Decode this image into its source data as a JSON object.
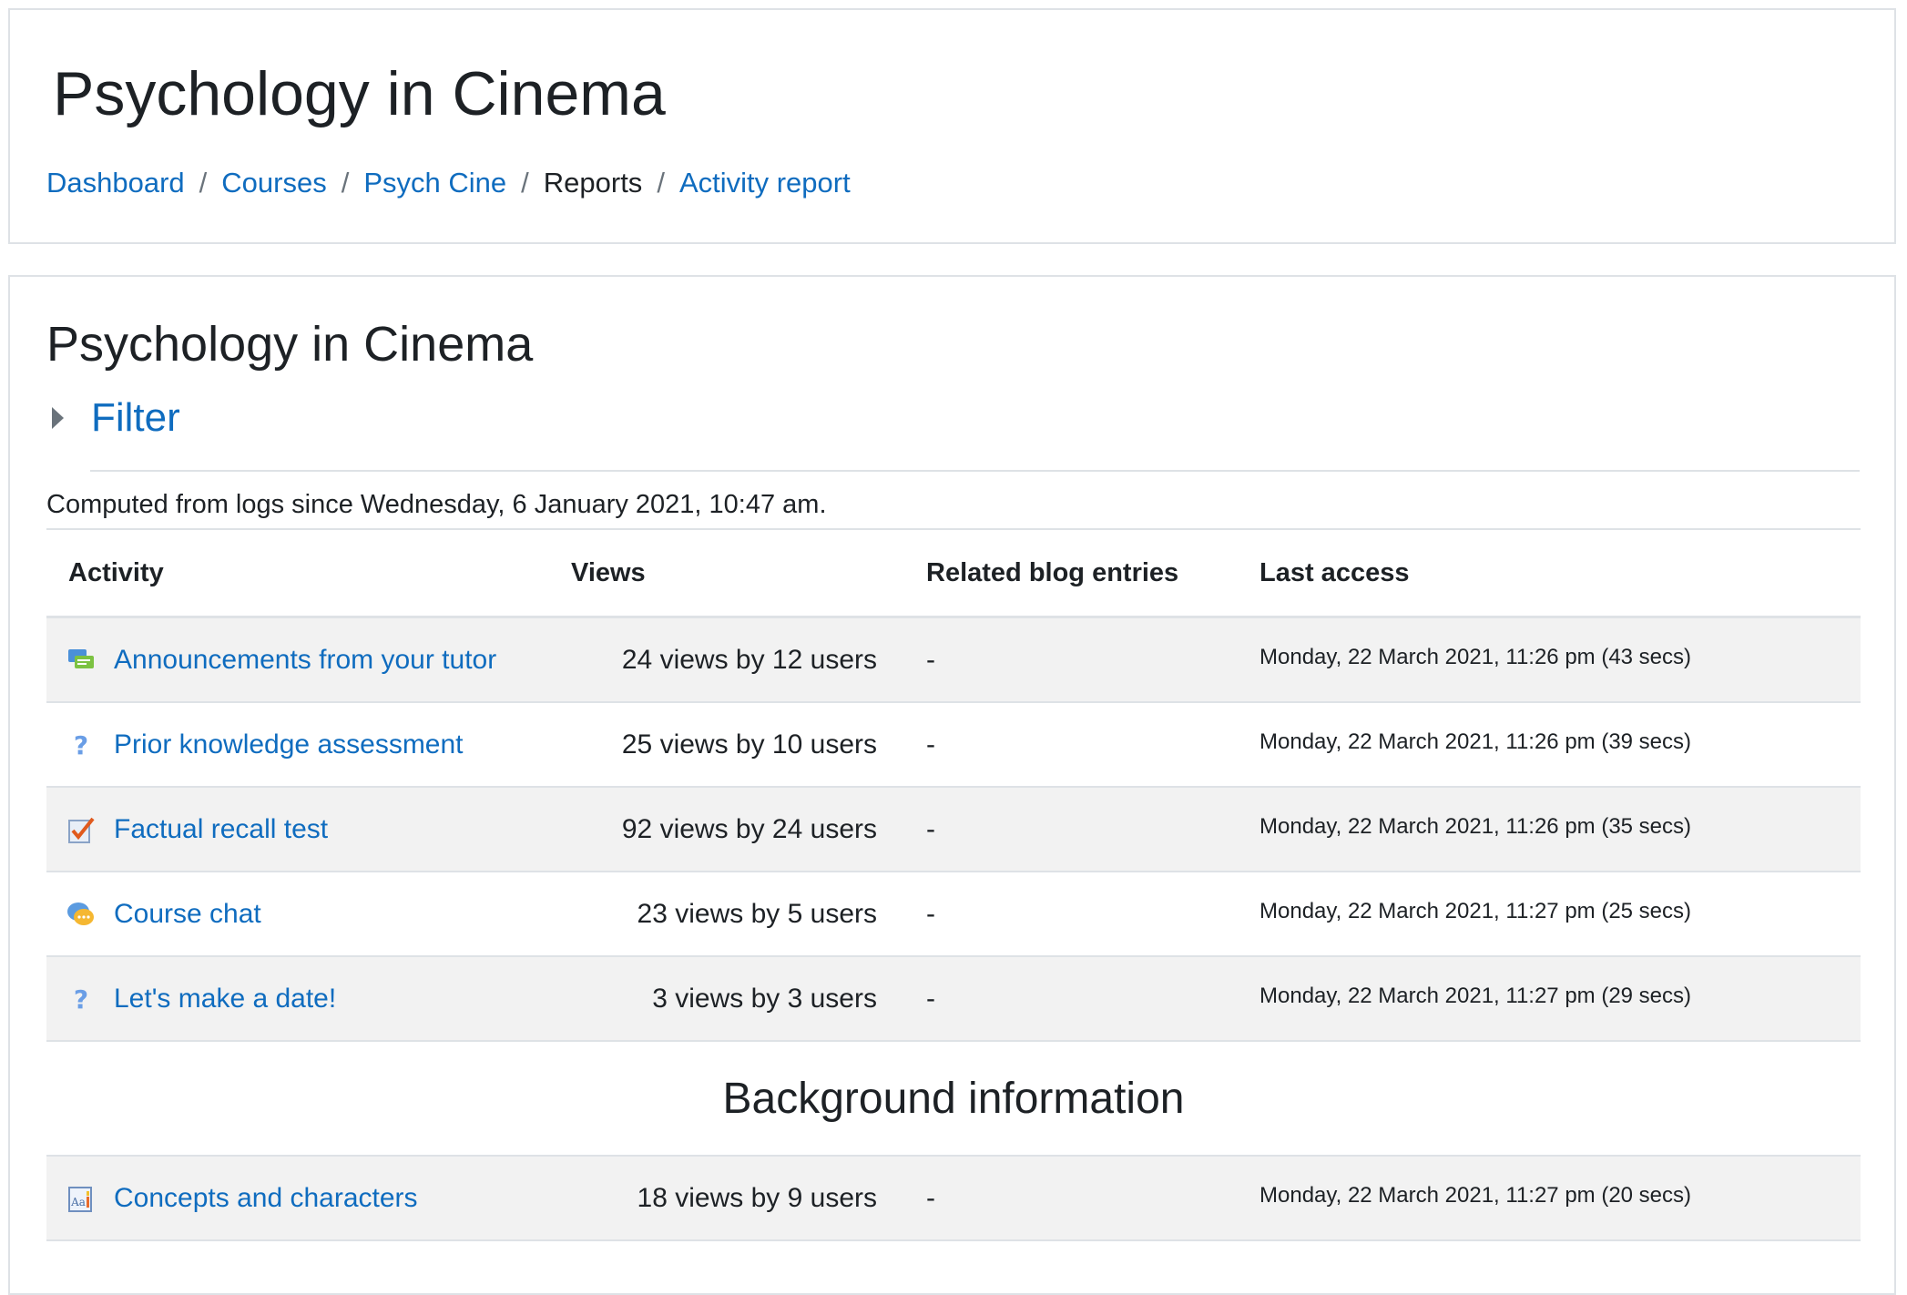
{
  "header": {
    "title": "Psychology in Cinema",
    "breadcrumb": [
      {
        "label": "Dashboard",
        "link": true
      },
      {
        "label": "Courses",
        "link": true
      },
      {
        "label": "Psych Cine",
        "link": true
      },
      {
        "label": "Reports",
        "link": false
      },
      {
        "label": "Activity report",
        "link": true
      }
    ],
    "separator": "/"
  },
  "main": {
    "title": "Psychology in Cinema",
    "filter_label": "Filter",
    "computed_note": "Computed from logs since Wednesday, 6 January 2021, 10:47 am.",
    "table": {
      "columns": {
        "activity": "Activity",
        "views": "Views",
        "blog": "Related blog entries",
        "last_access": "Last access"
      },
      "rows": [
        {
          "icon": "forum-icon",
          "activity": "Announcements from your tutor",
          "views": "24 views by 12 users",
          "blog": "-",
          "last_access": "Monday, 22 March 2021, 11:26 pm (43 secs)"
        },
        {
          "icon": "question-icon",
          "activity": "Prior knowledge assessment",
          "views": "25 views by 10 users",
          "blog": "-",
          "last_access": "Monday, 22 March 2021, 11:26 pm (39 secs)"
        },
        {
          "icon": "quiz-icon",
          "activity": "Factual recall test",
          "views": "92 views by 24 users",
          "blog": "-",
          "last_access": "Monday, 22 March 2021, 11:26 pm (35 secs)"
        },
        {
          "icon": "chat-icon",
          "activity": "Course chat",
          "views": "23 views by 5 users",
          "blog": "-",
          "last_access": "Monday, 22 March 2021, 11:27 pm (25 secs)"
        },
        {
          "icon": "question-icon",
          "activity": "Let's make a date!",
          "views": "3 views by 3 users",
          "blog": "-",
          "last_access": "Monday, 22 March 2021, 11:27 pm (29 secs)"
        }
      ],
      "section_title": "Background information",
      "section_rows": [
        {
          "icon": "glossary-icon",
          "activity": "Concepts and characters",
          "views": "18 views by 9 users",
          "blog": "-",
          "last_access": "Monday, 22 March 2021, 11:27 pm (20 secs)"
        }
      ]
    }
  },
  "colors": {
    "link": "#0f6cbf",
    "row_shade": "#f2f2f2",
    "border": "#dee2e6"
  }
}
